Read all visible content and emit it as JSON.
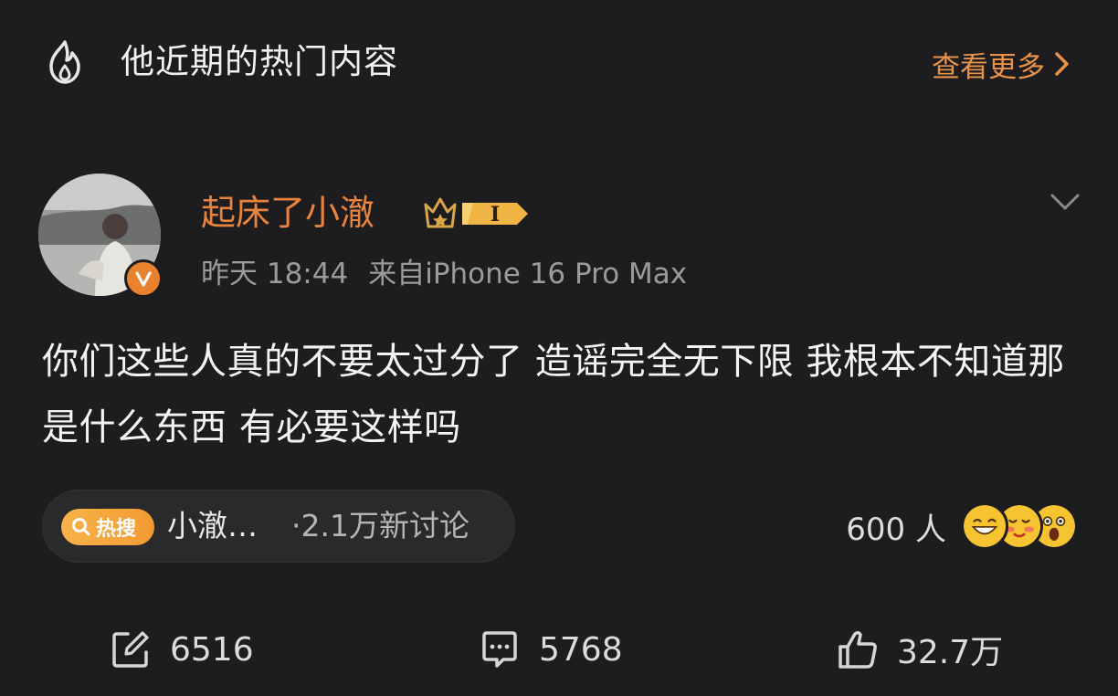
{
  "header": {
    "title": "他近期的热门内容",
    "view_more": "查看更多"
  },
  "post": {
    "author": "起床了小澈",
    "vip_level": "I",
    "time": "昨天 18:44",
    "source": "来自iPhone 16 Pro Max",
    "text": "你们这些人真的不要太过分了 造谣完全无下限 我根本不知道那是什么东西 有必要这样吗"
  },
  "trending": {
    "badge": "热搜",
    "topic": "小澈…",
    "count": "·2.1万新讨论"
  },
  "reactions": {
    "count": "600 人"
  },
  "actions": {
    "repost": "6516",
    "comment": "5768",
    "like": "32.7万"
  },
  "colors": {
    "background": "#1d1d1f",
    "accent_orange": "#e8843d",
    "hot_badge": "#f4a93e"
  }
}
